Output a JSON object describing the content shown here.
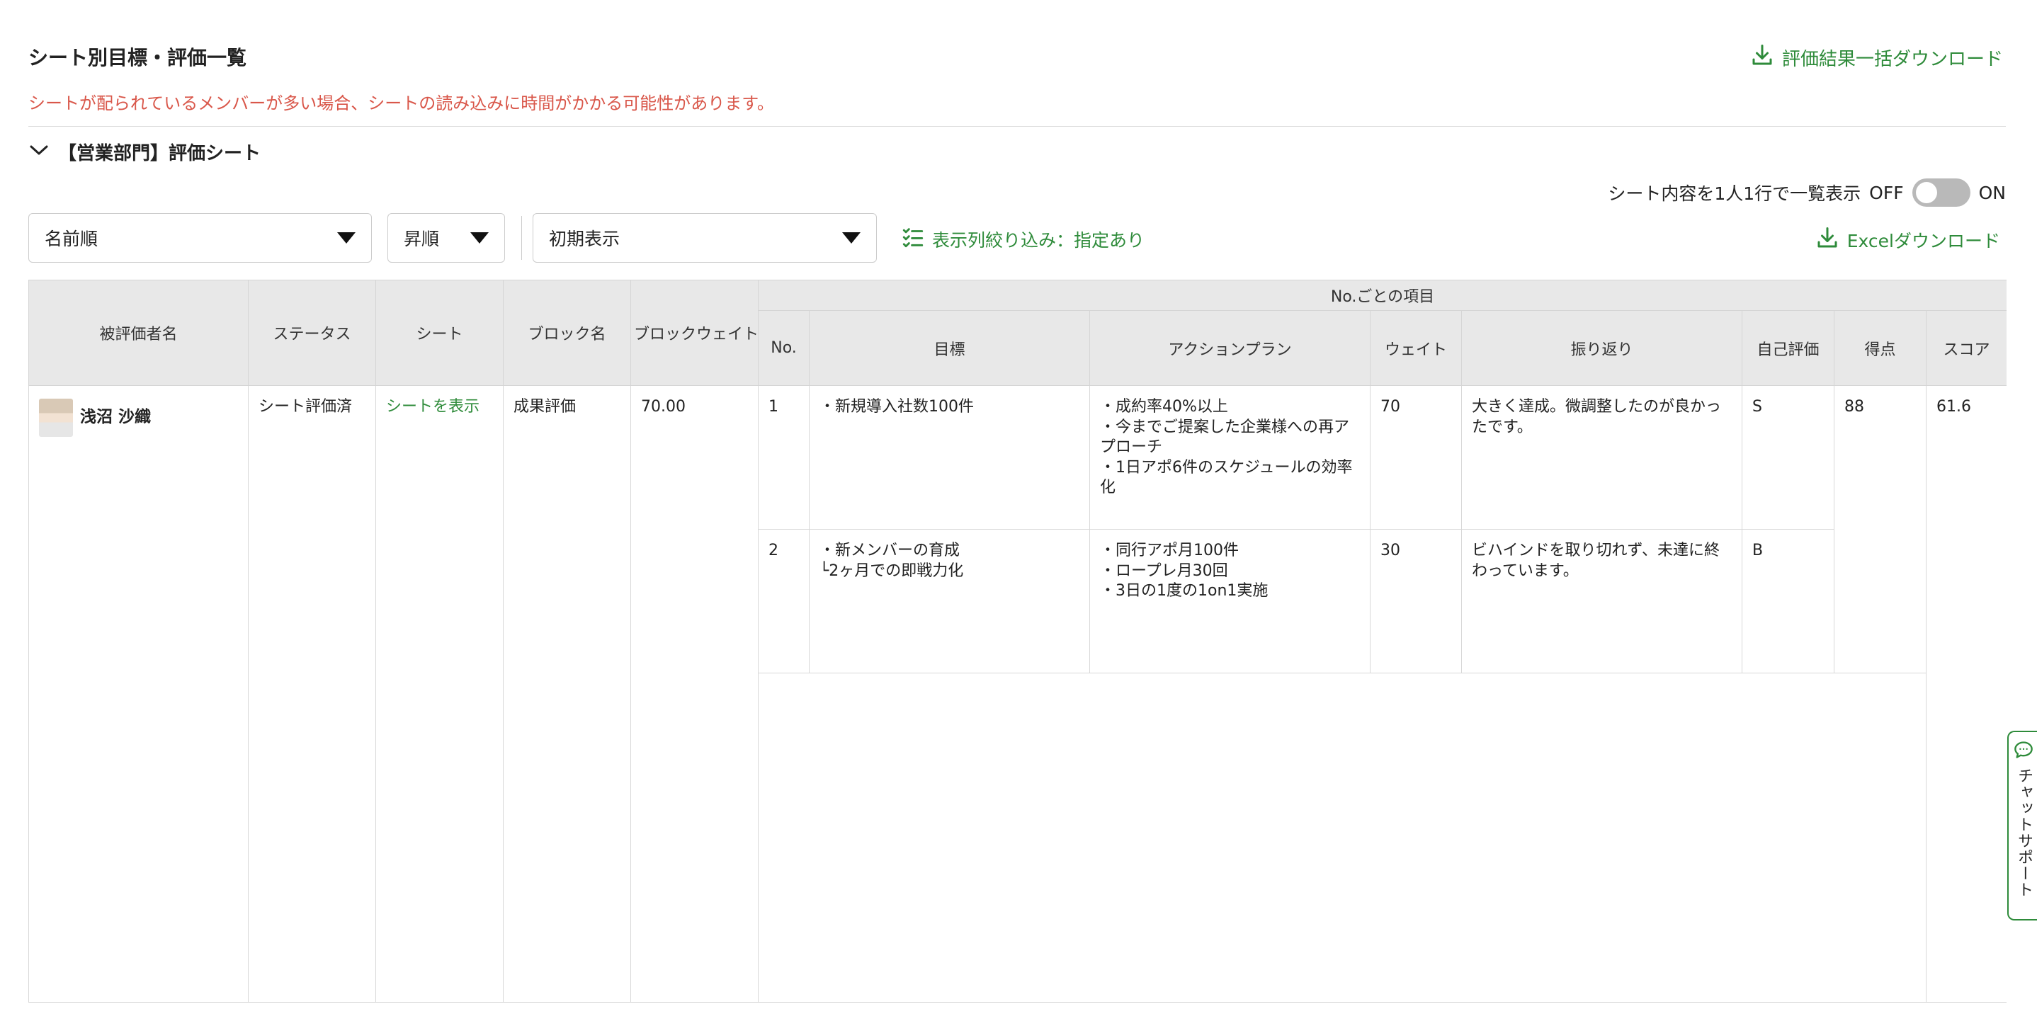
{
  "header": {
    "title": "シート別目標・評価一覧",
    "bulk_download_label": "評価結果一括ダウンロード",
    "warning": "シートが配られているメンバーが多い場合、シートの読み込みに時間がかかる可能性があります。"
  },
  "section": {
    "title": "【営業部門】評価シート",
    "expanded": true
  },
  "toggle": {
    "label": "シート内容を1人1行で一覧表示",
    "off_label": "OFF",
    "on_label": "ON",
    "state": "off"
  },
  "filters": {
    "sort_by": "名前順",
    "order": "昇順",
    "view": "初期表示",
    "column_filter_label": "表示列絞り込み：指定あり",
    "excel_download_label": "Excelダウンロード"
  },
  "table": {
    "headers": {
      "evaluee": "被評価者名",
      "status": "ステータス",
      "sheet": "シート",
      "block_name": "ブロック名",
      "block_weight": "ブロックウェイト",
      "group": "No.ごとの項目",
      "no": "No.",
      "goal": "目標",
      "action_plan": "アクションプラン",
      "weight": "ウェイト",
      "reflection": "振り返り",
      "self_eval": "自己評価",
      "points": "得点",
      "score": "スコア"
    },
    "row": {
      "name": "浅沼 沙織",
      "status": "シート評価済",
      "sheet_link": "シートを表示",
      "block_name": "成果評価",
      "block_weight": "70.00",
      "points": "88",
      "score": "61.6",
      "items": [
        {
          "no": "1",
          "goal": "・新規導入社数100件",
          "action_plan": "・成約率40%以上\n・今までご提案した企業様への再アプローチ\n・1日アポ6件のスケジュールの効率化",
          "weight": "70",
          "reflection": "大きく達成。微調整したのが良かったです。",
          "self_eval": "S"
        },
        {
          "no": "2",
          "goal": "・新メンバーの育成\n└2ヶ月での即戦力化",
          "action_plan": "・同行アポ月100件\n・ロープレ月30回\n・3日の1度の1on1実施",
          "weight": "30",
          "reflection": "ビハインドを取り切れず、未達に終わっています。",
          "self_eval": "B"
        }
      ]
    }
  },
  "chat_support": {
    "label": "チャットサポート"
  },
  "colors": {
    "accent": "#2e8b3a",
    "warning": "#d9574a",
    "header_bg": "#e8e8e8"
  }
}
